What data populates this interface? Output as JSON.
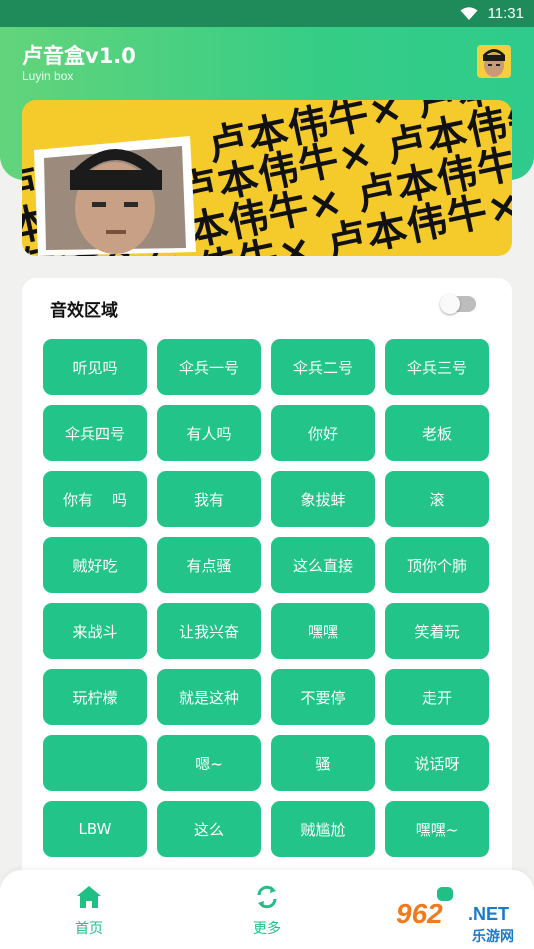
{
  "status_bar": {
    "time": "11:31"
  },
  "header": {
    "title": "卢音盒v1.0",
    "subtitle": "Luyin box"
  },
  "banner": {
    "text": "卢本伟牛× 卢本伟牛× 卢本伟牛×"
  },
  "sound_section": {
    "title": "音效区域",
    "toggle_on": false,
    "buttons": [
      "听见吗",
      "伞兵一号",
      "伞兵二号",
      "伞兵三号",
      "伞兵四号",
      "有人吗",
      "你好",
      "老板",
      "你有    吗",
      "我有",
      "象拔蚌",
      "滚",
      "贼好吃",
      "有点骚",
      "这么直接",
      "顶你个肺",
      "来战斗",
      "让我兴奋",
      "嘿嘿",
      "笑着玩",
      "玩柠檬",
      "就是这种",
      "不要停",
      "走开",
      "",
      "嗯~",
      "骚",
      "说话呀",
      "LBW",
      "这么",
      "贼尴尬",
      "嘿嘿~"
    ]
  },
  "nav": {
    "home_label": "首页",
    "more_label": "更多"
  },
  "watermark": {
    "num": "962",
    "net": ".NET",
    "cn": "乐游网"
  },
  "colors": {
    "accent": "#22c48a",
    "header": "#35cd86",
    "status_bar": "#1f8a5a"
  }
}
